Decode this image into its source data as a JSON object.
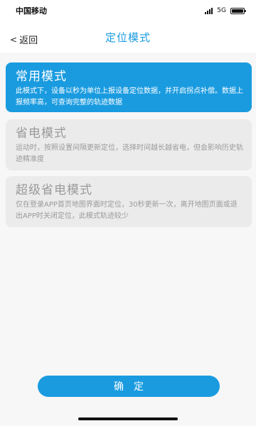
{
  "status_bar": {
    "carrier": "中国移动",
    "network": "5G",
    "icons": [
      "signal-icon",
      "battery-icon"
    ]
  },
  "nav": {
    "back_label": "返回",
    "back_icon": "<",
    "title": "定位模式"
  },
  "modes": [
    {
      "title": "常用模式",
      "description": "此模式下，设备以秒为单位上报设备定位数据，并开启拐点补偿。数据上报频率高，可查询完整的轨迹数据",
      "selected": true
    },
    {
      "title": "省电模式",
      "description": "运动时，按照设置间隔更新定位，选择时间越长越省电，但会影响历史轨迹精准度",
      "selected": false
    },
    {
      "title": "超级省电模式",
      "description": "仅在登录APP首页地图界面时定位，30秒更新一次，离开地图页面或退出APP时关闭定位，此模式轨迹较少",
      "selected": false
    }
  ],
  "confirm_label": "确定",
  "colors": {
    "accent": "#1a9be0",
    "card_inactive": "#ebebeb",
    "text_inactive": "#9a9a9a",
    "background": "#f7f7f7"
  }
}
